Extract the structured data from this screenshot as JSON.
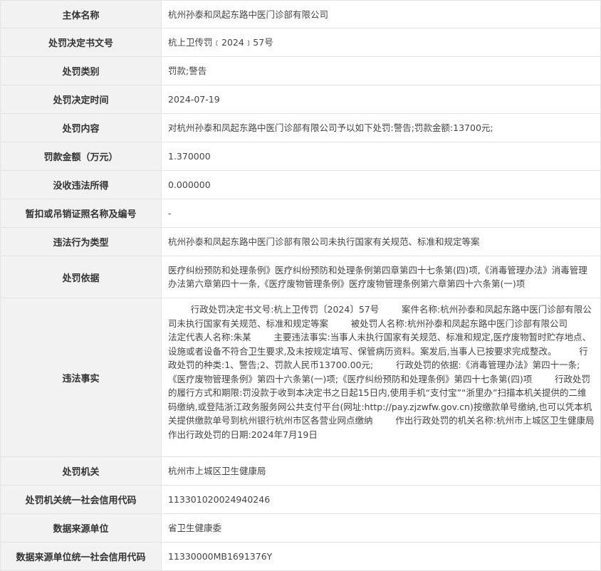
{
  "rows": [
    {
      "label": "主体名称",
      "value": "杭州孙泰和凤起东路中医门诊部有限公司"
    },
    {
      "label": "处罚决定书文号",
      "value": "杭上卫传罚﹝2024﹞57号"
    },
    {
      "label": "处罚类别",
      "value": "罚款;警告"
    },
    {
      "label": "处罚决定时间",
      "value": "2024-07-19"
    },
    {
      "label": "处罚内容",
      "value": "对杭州孙泰和凤起东路中医门诊部有限公司予以如下处罚:警告;罚款金额:13700元;"
    },
    {
      "label": "罚款金额（万元）",
      "value": "1.370000"
    },
    {
      "label": "没收违法所得",
      "value": "0.000000"
    },
    {
      "label": "暂扣或吊销证照名称及编号",
      "value": "-"
    },
    {
      "label": "违法行为类型",
      "value": "杭州孙泰和凤起东路中医门诊部有限公司未执行国家有关规范、标准和规定等案"
    },
    {
      "label": "处罚依据",
      "value": "医疗纠纷预防和处理条例》医疗纠纷预防和处理条例第四章第四十七条第(四)项,《消毒管理办法》消毒管理办法第六章第四十一条,《医疗废物管理条例》医疗废物管理条例第六章第四十六条第(一)项"
    },
    {
      "label": "违法事实",
      "value": "        行政处罚决定书文号:杭上卫传罚〔2024〕57号        案件名称:杭州孙泰和凤起东路中医门诊部有限公司未执行国家有关规范、标准和规定等案        被处罚人名称:杭州孙泰和凤起东路中医门诊部有限公司        法定代表人名称:朱某        主要违法事实:当事人未执行国家有关规范、标准和规定,医疗废物暂时贮存地点、设施或者设备不符合卫生要求,及未按规定填写、保管病历资料。案发后,当事人已按要求完成整改。        行政处罚的种类:1、警告;2、罚款人民币13700.00元;        行政处罚的依据:《消毒管理办法》第四十一条;《医疗废物管理条例》第四十六条第(一)项;《医疗纠纷预防和处理条例》第四十七条第(四)项        行政处罚的履行方式和期限:罚没款于收到本决定书之日起15日内,使用手机“支付宝”“浙里办”扫描本机关提供的二维码缴纳,或登陆浙江政务服务网公共支付平台(网址:http://pay.zjzwfw.gov.cn)按缴款单号缴纳,也可以凭本机关提供缴款单号到杭州银行杭州市区各营业网点缴纳        作出行政处罚的机关名称:杭州市上城区卫生健康局        作出行政处罚的日期:2024年7月19日"
    },
    {
      "label": "处罚机关",
      "value": "杭州市上城区卫生健康局"
    },
    {
      "label": "处罚机关统一社会信用代码",
      "value": "113301020024940246"
    },
    {
      "label": "数据来源单位",
      "value": "省卫生健康委"
    },
    {
      "label": "数据来源单位统一社会信用代码",
      "value": "11330000MB1691376Y"
    }
  ]
}
